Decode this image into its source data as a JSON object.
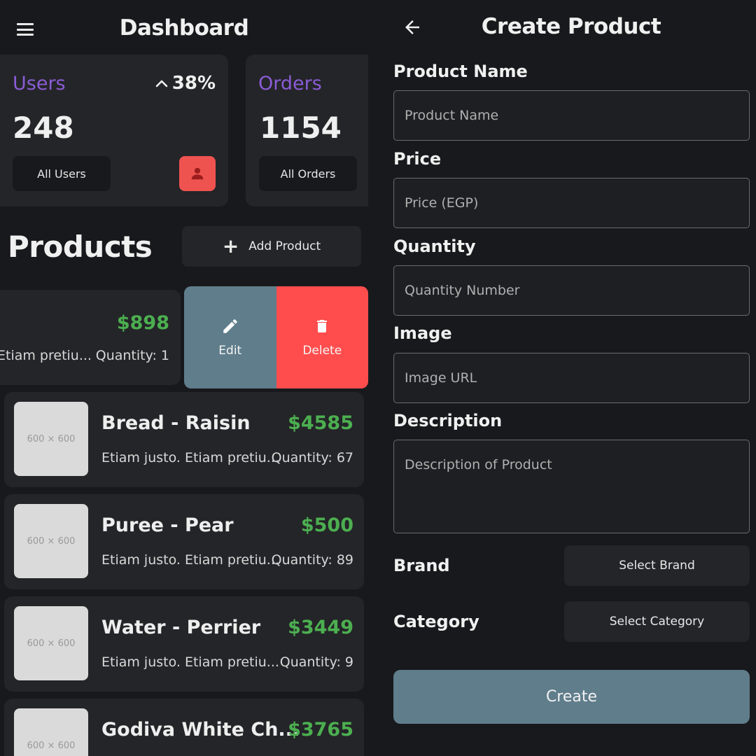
{
  "dashboard": {
    "title": "Dashboard",
    "users_card": {
      "label": "Users",
      "value": "248",
      "change": "38%",
      "button": "All Users"
    },
    "orders_card": {
      "label": "Orders",
      "value": "1154",
      "button": "All Orders"
    },
    "products_title": "Products",
    "add_product": "Add Product",
    "swiped_item": {
      "price": "$898",
      "description": "Etiam pretiu...",
      "quantity": "Quantity: 1",
      "edit_label": "Edit",
      "delete_label": "Delete"
    },
    "products": [
      {
        "thumb": "600 × 600",
        "name": "Bread - Raisin",
        "price": "$4585",
        "description": "Etiam justo. Etiam pretiu...",
        "quantity": "Quantity: 67"
      },
      {
        "thumb": "600 × 600",
        "name": "Puree - Pear",
        "price": "$500",
        "description": "Etiam justo. Etiam pretiu...",
        "quantity": "Quantity: 89"
      },
      {
        "thumb": "600 × 600",
        "name": "Water - Perrier",
        "price": "$3449",
        "description": "Etiam justo. Etiam pretiu...",
        "quantity": "Quantity: 9"
      },
      {
        "thumb": "600 × 600",
        "name": "Godiva White Ch...",
        "price": "$3765",
        "description": "",
        "quantity": ""
      }
    ]
  },
  "create_product": {
    "title": "Create Product",
    "fields": {
      "product_name": {
        "label": "Product Name",
        "placeholder": "Product Name"
      },
      "price": {
        "label": "Price",
        "placeholder": "Price (EGP)"
      },
      "quantity": {
        "label": "Quantity",
        "placeholder": "Quantity Number"
      },
      "image": {
        "label": "Image",
        "placeholder": "Image URL"
      },
      "description": {
        "label": "Description",
        "placeholder": "Description of Product"
      }
    },
    "brand": {
      "label": "Brand",
      "button": "Select Brand"
    },
    "category": {
      "label": "Category",
      "button": "Select Category"
    },
    "create_button": "Create"
  },
  "colors": {
    "background": "#18191c",
    "card": "#242528",
    "accent_purple": "#8a5cd6",
    "price_green": "#4caf50",
    "edit_blue_grey": "#607d8b",
    "delete_red": "#ff4d4d",
    "user_badge_red": "#ef5350"
  },
  "icons": [
    "menu-icon",
    "chevron-up-icon",
    "person-icon",
    "plus-icon",
    "pencil-icon",
    "trash-icon",
    "arrow-back-icon"
  ]
}
